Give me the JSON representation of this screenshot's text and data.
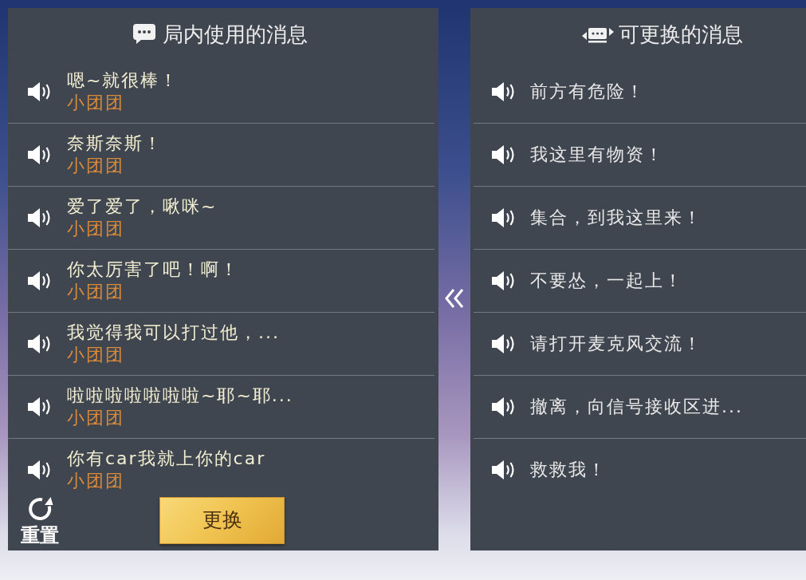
{
  "in_game_panel": {
    "title": "局内使用的消息",
    "messages": [
      {
        "text": "嗯~就很棒！",
        "author": "小团团"
      },
      {
        "text": "奈斯奈斯！",
        "author": "小团团"
      },
      {
        "text": "爱了爱了，啾咪~",
        "author": "小团团"
      },
      {
        "text": "你太厉害了吧！啊！",
        "author": "小团团"
      },
      {
        "text": "我觉得我可以打过他，...",
        "author": "小团团"
      },
      {
        "text": "啦啦啦啦啦啦啦~耶~耶...",
        "author": "小团团"
      },
      {
        "text": "你有car我就上你的car",
        "author": "小团团"
      }
    ],
    "reset_button": {
      "label": "重置"
    },
    "replace_button": {
      "label": "更换"
    }
  },
  "replaceable_panel": {
    "title": "可更换的消息",
    "messages": [
      {
        "text": "前方有危险！"
      },
      {
        "text": "我这里有物资！"
      },
      {
        "text": "集合，到我这里来！"
      },
      {
        "text": "不要怂，一起上！"
      },
      {
        "text": "请打开麦克风交流！"
      },
      {
        "text": "撤离，向信号接收区进..."
      },
      {
        "text": "救救我！"
      }
    ]
  }
}
